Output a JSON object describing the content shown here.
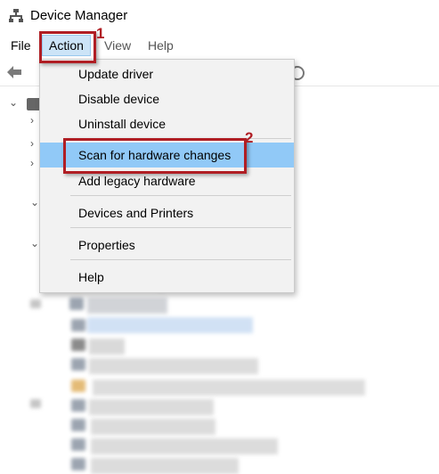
{
  "window": {
    "title": "Device Manager",
    "icon": "device-manager-icon"
  },
  "menubar": {
    "file": "File",
    "action": "Action",
    "view": "View",
    "help": "Help"
  },
  "action_menu": {
    "items": [
      {
        "label": "Update driver"
      },
      {
        "label": "Disable device"
      },
      {
        "label": "Uninstall device"
      },
      {
        "label": "Scan for hardware changes",
        "highlighted": true
      },
      {
        "label": "Add legacy hardware"
      },
      {
        "label": "Devices and Printers"
      },
      {
        "label": "Properties"
      },
      {
        "label": "Help"
      }
    ]
  },
  "callouts": {
    "one": "1",
    "two": "2",
    "color": "#b01e24"
  },
  "colors": {
    "menu_highlight": "#91c9f7",
    "menu_bg": "#f2f2f2",
    "active_menu": "#cce4f7"
  }
}
